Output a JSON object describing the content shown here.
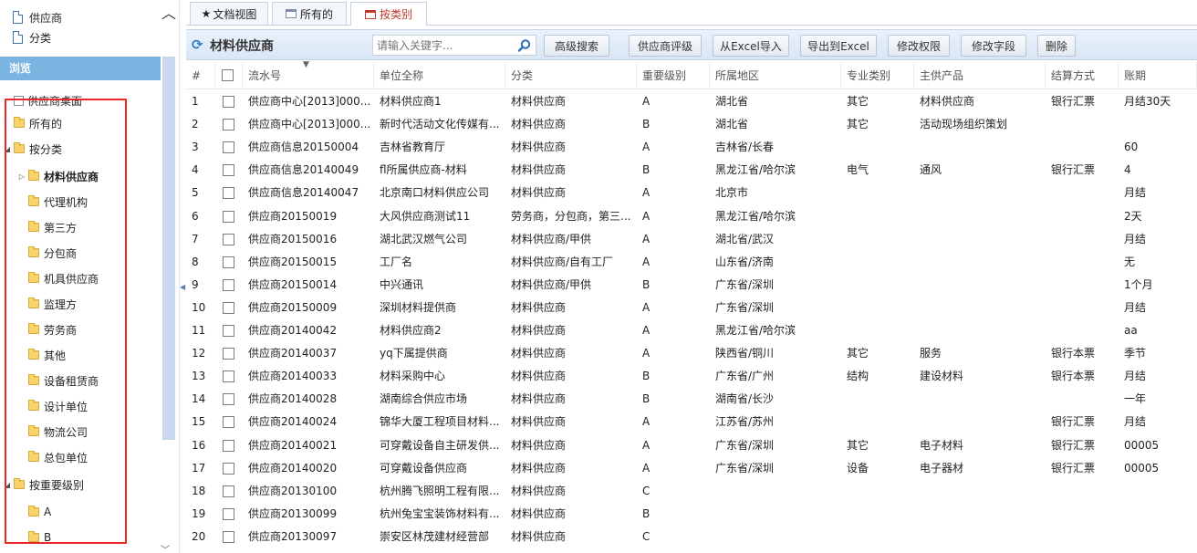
{
  "left_top": {
    "items": [
      "供应商",
      "分类"
    ]
  },
  "browse": {
    "title": "浏览"
  },
  "tree": [
    {
      "label": "供应商桌面",
      "kind": "page",
      "level": 0,
      "tri": ""
    },
    {
      "label": "所有的",
      "kind": "folder",
      "level": 0,
      "tri": ""
    },
    {
      "label": "按分类",
      "kind": "folder",
      "level": 0,
      "tri": "◢"
    },
    {
      "label": "材料供应商",
      "kind": "folder",
      "level": 1,
      "tri": "▷",
      "bold": true
    },
    {
      "label": "代理机构",
      "kind": "folder",
      "level": 1,
      "tri": ""
    },
    {
      "label": "第三方",
      "kind": "folder",
      "level": 1,
      "tri": ""
    },
    {
      "label": "分包商",
      "kind": "folder",
      "level": 1,
      "tri": ""
    },
    {
      "label": "机具供应商",
      "kind": "folder",
      "level": 1,
      "tri": ""
    },
    {
      "label": "监理方",
      "kind": "folder",
      "level": 1,
      "tri": ""
    },
    {
      "label": "劳务商",
      "kind": "folder",
      "level": 1,
      "tri": ""
    },
    {
      "label": "其他",
      "kind": "folder",
      "level": 1,
      "tri": ""
    },
    {
      "label": "设备租赁商",
      "kind": "folder",
      "level": 1,
      "tri": ""
    },
    {
      "label": "设计单位",
      "kind": "folder",
      "level": 1,
      "tri": ""
    },
    {
      "label": "物流公司",
      "kind": "folder",
      "level": 1,
      "tri": ""
    },
    {
      "label": "总包单位",
      "kind": "folder",
      "level": 1,
      "tri": ""
    },
    {
      "label": "按重要级别",
      "kind": "folder",
      "level": 0,
      "tri": "◢"
    },
    {
      "label": "A",
      "kind": "folder",
      "level": 1,
      "tri": ""
    },
    {
      "label": "B",
      "kind": "folder",
      "level": 1,
      "tri": ""
    }
  ],
  "tabs": [
    {
      "label": "文档视图",
      "prefix": "★"
    },
    {
      "label": "所有的",
      "prefix": ""
    },
    {
      "label": "按类别",
      "prefix": ""
    }
  ],
  "toolbar": {
    "title": "材料供应商",
    "search_placeholder": "请输入关键字...",
    "buttons": [
      "高级搜索",
      "供应商评级",
      "从Excel导入",
      "导出到Excel",
      "修改权限",
      "修改字段",
      "删除"
    ]
  },
  "grid": {
    "columns": [
      "#",
      "",
      "流水号",
      "单位全称",
      "分类",
      "重要级别",
      "所属地区",
      "专业类别",
      "主供产品",
      "结算方式",
      "账期"
    ],
    "rows": [
      [
        "1",
        "供应商中心[2013]000...",
        "材料供应商1",
        "材料供应商",
        "A",
        "湖北省",
        "其它",
        "材料供应商",
        "银行汇票",
        "月结30天"
      ],
      [
        "2",
        "供应商中心[2013]000...",
        "新时代活动文化传媒有...",
        "材料供应商",
        "B",
        "湖北省",
        "其它",
        "活动现场组织策划",
        "",
        ""
      ],
      [
        "3",
        "供应商信息20150004",
        "吉林省教育厅",
        "材料供应商",
        "A",
        "吉林省/长春",
        "",
        "",
        "",
        "60"
      ],
      [
        "4",
        "供应商信息20140049",
        "fl所属供应商-材料",
        "材料供应商",
        "B",
        "黑龙江省/哈尔滨",
        "电气",
        "通风",
        "银行汇票",
        "4"
      ],
      [
        "5",
        "供应商信息20140047",
        "北京南口材料供应公司",
        "材料供应商",
        "A",
        "北京市",
        "",
        "",
        "",
        "月结"
      ],
      [
        "6",
        "供应商20150019",
        "大风供应商测试11",
        "劳务商，分包商，第三...",
        "A",
        "黑龙江省/哈尔滨",
        "",
        "",
        "",
        "2天"
      ],
      [
        "7",
        "供应商20150016",
        "湖北武汉燃气公司",
        "材料供应商/甲供",
        "A",
        "湖北省/武汉",
        "",
        "",
        "",
        "月结"
      ],
      [
        "8",
        "供应商20150015",
        "工厂名",
        "材料供应商/自有工厂",
        "A",
        "山东省/济南",
        "",
        "",
        "",
        "无"
      ],
      [
        "9",
        "供应商20150014",
        "中兴通讯",
        "材料供应商/甲供",
        "B",
        "广东省/深圳",
        "",
        "",
        "",
        "1个月"
      ],
      [
        "10",
        "供应商20150009",
        "深圳材料提供商",
        "材料供应商",
        "A",
        "广东省/深圳",
        "",
        "",
        "",
        "月结"
      ],
      [
        "11",
        "供应商20140042",
        "材料供应商2",
        "材料供应商",
        "A",
        "黑龙江省/哈尔滨",
        "",
        "",
        "",
        "aa"
      ],
      [
        "12",
        "供应商20140037",
        "yq下属提供商",
        "材料供应商",
        "A",
        "陕西省/铜川",
        "其它",
        "服务",
        "银行本票",
        "季节"
      ],
      [
        "13",
        "供应商20140033",
        "材料采购中心",
        "材料供应商",
        "B",
        "广东省/广州",
        "结构",
        "建设材料",
        "银行本票",
        "月结"
      ],
      [
        "14",
        "供应商20140028",
        "湖南综合供应市场",
        "材料供应商",
        "B",
        "湖南省/长沙",
        "",
        "",
        "",
        "一年"
      ],
      [
        "15",
        "供应商20140024",
        "锦华大厦工程项目材料...",
        "材料供应商",
        "A",
        "江苏省/苏州",
        "",
        "",
        "银行汇票",
        "月结"
      ],
      [
        "16",
        "供应商20140021",
        "可穿戴设备自主研发供...",
        "材料供应商",
        "A",
        "广东省/深圳",
        "其它",
        "电子材料",
        "银行汇票",
        "00005"
      ],
      [
        "17",
        "供应商20140020",
        "可穿戴设备供应商",
        "材料供应商",
        "A",
        "广东省/深圳",
        "设备",
        "电子器材",
        "银行汇票",
        "00005"
      ],
      [
        "18",
        "供应商20130100",
        "杭州腾飞照明工程有限...",
        "材料供应商",
        "C",
        "",
        "",
        "",
        "",
        ""
      ],
      [
        "19",
        "供应商20130099",
        "杭州兔宝宝装饰材料有...",
        "材料供应商",
        "B",
        "",
        "",
        "",
        "",
        ""
      ],
      [
        "20",
        "供应商20130097",
        "崇安区林茂建材经营部",
        "材料供应商",
        "C",
        "",
        "",
        "",
        "",
        ""
      ]
    ]
  }
}
